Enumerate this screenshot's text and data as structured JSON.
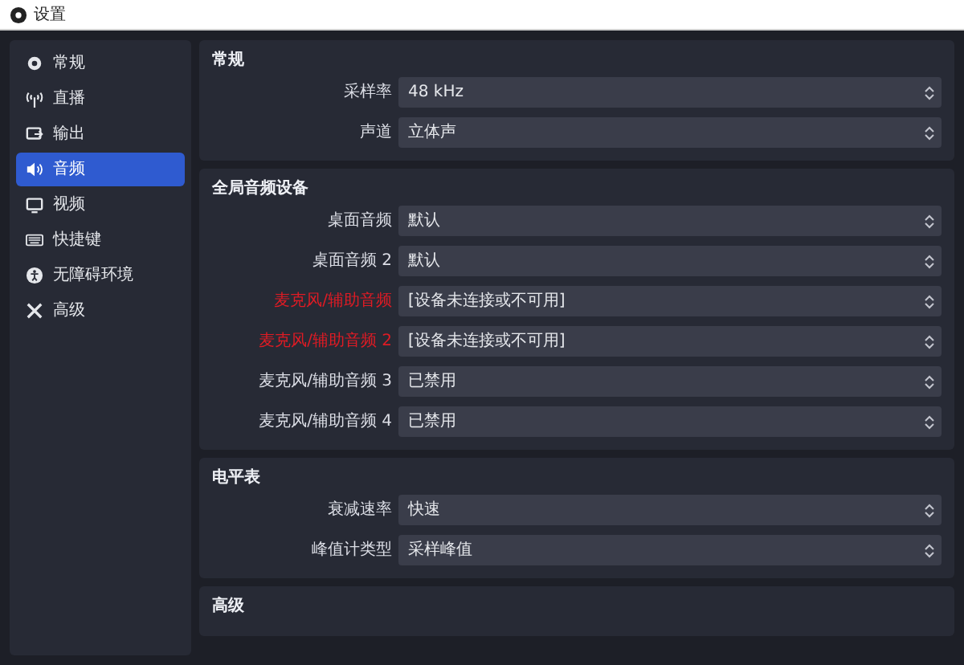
{
  "window": {
    "title": "设置"
  },
  "sidebar": {
    "items": [
      {
        "label": "常规",
        "selected": false
      },
      {
        "label": "直播",
        "selected": false
      },
      {
        "label": "输出",
        "selected": false
      },
      {
        "label": "音频",
        "selected": true
      },
      {
        "label": "视频",
        "selected": false
      },
      {
        "label": "快捷键",
        "selected": false
      },
      {
        "label": "无障碍环境",
        "selected": false
      },
      {
        "label": "高级",
        "selected": false
      }
    ]
  },
  "sections": [
    {
      "title": "常规",
      "rows": [
        {
          "label": "采样率",
          "value": "48 kHz",
          "error": false
        },
        {
          "label": "声道",
          "value": "立体声",
          "error": false
        }
      ]
    },
    {
      "title": "全局音频设备",
      "rows": [
        {
          "label": "桌面音频",
          "value": "默认",
          "error": false
        },
        {
          "label": "桌面音频 2",
          "value": "默认",
          "error": false
        },
        {
          "label": "麦克风/辅助音频",
          "value": "[设备未连接或不可用]",
          "error": true
        },
        {
          "label": "麦克风/辅助音频 2",
          "value": "[设备未连接或不可用]",
          "error": true
        },
        {
          "label": "麦克风/辅助音频 3",
          "value": "已禁用",
          "error": false
        },
        {
          "label": "麦克风/辅助音频 4",
          "value": "已禁用",
          "error": false
        }
      ]
    },
    {
      "title": "电平表",
      "rows": [
        {
          "label": "衰减速率",
          "value": "快速",
          "error": false
        },
        {
          "label": "峰值计类型",
          "value": "采样峰值",
          "error": false
        }
      ]
    },
    {
      "title": "高级"
    }
  ]
}
